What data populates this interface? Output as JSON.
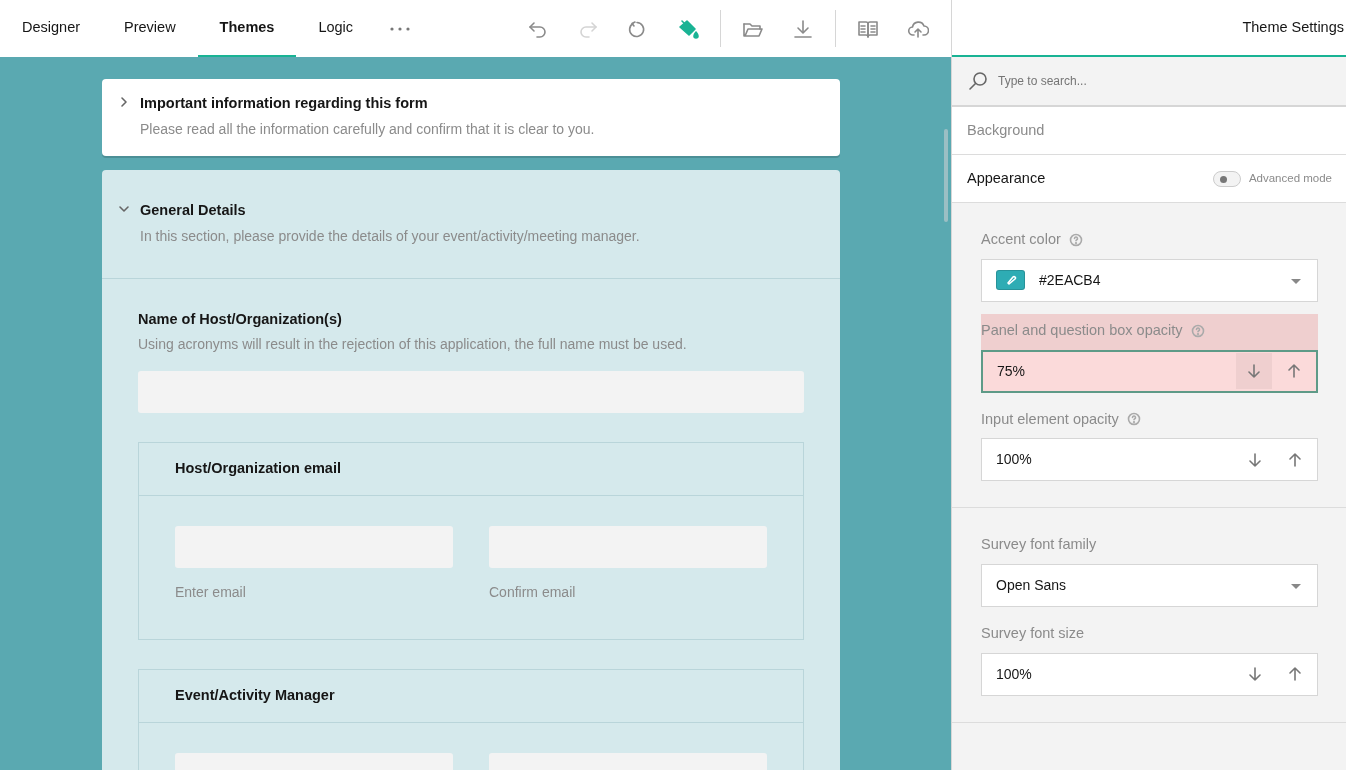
{
  "tabs": [
    {
      "label": "Designer",
      "selected": false
    },
    {
      "label": "Preview",
      "selected": false
    },
    {
      "label": "Themes",
      "selected": true
    },
    {
      "label": "Logic",
      "selected": false
    }
  ],
  "toolbar": [
    {
      "kind": "undo",
      "disabled": false,
      "selected": false
    },
    {
      "kind": "redo",
      "disabled": true,
      "selected": false
    },
    {
      "kind": "reset",
      "disabled": false,
      "selected": false
    },
    {
      "kind": "theme",
      "disabled": false,
      "selected": true
    },
    {
      "kind": "divider"
    },
    {
      "kind": "open",
      "disabled": false,
      "selected": false
    },
    {
      "kind": "download",
      "disabled": false,
      "selected": false
    },
    {
      "kind": "divider"
    },
    {
      "kind": "book",
      "disabled": false,
      "selected": false
    },
    {
      "kind": "upload",
      "disabled": false,
      "selected": false
    }
  ],
  "survey": {
    "pages": [
      {
        "title": "Important information regarding this form",
        "description": "Please read all the information carefully and confirm that it is clear to you.",
        "expanded": false
      },
      {
        "title": "General Details",
        "description": "In this section, please provide the details of your event/activity/meeting manager.",
        "expanded": true,
        "questions": [
          {
            "kind": "text",
            "title": "Name of Host/Organization(s)",
            "description": "Using acronyms will result in the rejection of this application, the full name must be used."
          },
          {
            "kind": "panel",
            "title": "Host/Organization email",
            "fields": [
              {
                "kind": "input",
                "label": "Enter email"
              },
              {
                "kind": "input",
                "label": "Confirm email"
              }
            ]
          },
          {
            "kind": "panel",
            "title": "Event/Activity Manager",
            "fields": [
              {
                "kind": "input"
              },
              {
                "kind": "input"
              }
            ]
          }
        ]
      }
    ]
  },
  "settings": {
    "title": "Theme Settings",
    "search": {
      "placeholder": "Type to search..."
    },
    "sections": [
      {
        "title": "Background",
        "expanded": false
      },
      {
        "title": "Appearance",
        "expanded": true,
        "advanced_mode": {
          "label": "Advanced mode",
          "on": false
        }
      }
    ],
    "groups": [
      [
        {
          "kind": "color",
          "label": "Accent color",
          "help": true,
          "value": "#2EACB4",
          "color": "#2eacb4"
        },
        {
          "kind": "spinner",
          "label": "Panel and question box opacity",
          "help": true,
          "value": "75%",
          "highlighted": true,
          "down_hovered": true
        },
        {
          "kind": "spinner",
          "label": "Input element opacity",
          "help": true,
          "value": "100%",
          "highlighted": false,
          "down_hovered": false
        }
      ],
      [
        {
          "kind": "dropdown",
          "label": "Survey font family",
          "help": false,
          "value": "Open Sans"
        },
        {
          "kind": "spinner",
          "label": "Survey font size",
          "help": false,
          "value": "100%",
          "highlighted": false,
          "down_hovered": false
        }
      ]
    ]
  }
}
